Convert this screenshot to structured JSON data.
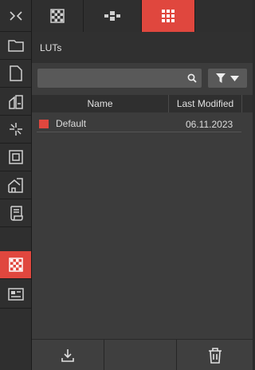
{
  "rail": {
    "items": [
      {
        "icon": "collapse-chevrons-icon"
      },
      {
        "icon": "folder-icon"
      },
      {
        "icon": "document-icon"
      },
      {
        "icon": "plan-icon"
      },
      {
        "icon": "light-icon"
      },
      {
        "icon": "frame-icon"
      },
      {
        "icon": "building-icon"
      },
      {
        "icon": "script-icon"
      },
      {
        "icon": "checker-icon",
        "active": true
      },
      {
        "icon": "id-card-icon"
      }
    ]
  },
  "tabs": [
    {
      "icon": "checker-icon"
    },
    {
      "icon": "nodes-icon"
    },
    {
      "icon": "grid-icon",
      "active": true
    }
  ],
  "panel": {
    "title": "LUTs",
    "search": {
      "value": "",
      "placeholder": ""
    },
    "columns": {
      "name": "Name",
      "last_modified": "Last Modified"
    },
    "rows": [
      {
        "name": "Default",
        "date": "06.11.2023",
        "color": "#e0473e"
      }
    ]
  },
  "footer": {
    "buttons": [
      {
        "icon": "download-icon"
      },
      {
        "icon": ""
      },
      {
        "icon": "trash-icon"
      }
    ]
  },
  "colors": {
    "accent": "#e0473e",
    "panel": "#3c3c3c",
    "rail": "#2f2f2f"
  }
}
